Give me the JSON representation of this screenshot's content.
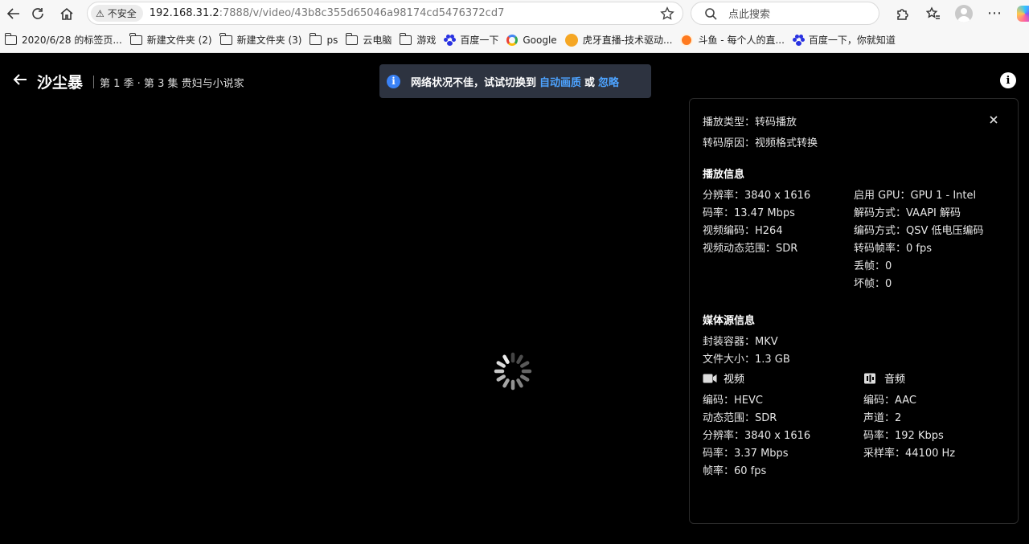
{
  "browser": {
    "security_label": "不安全",
    "url_host": "192.168.31.2",
    "url_rest": ":7888/v/video/43b8c355d65046a98174cd5476372cd7",
    "search_placeholder": "点此搜索"
  },
  "bookmarks": [
    {
      "label": "2020/6/28 的标签页...",
      "icon": "folder-icon"
    },
    {
      "label": "新建文件夹 (2)",
      "icon": "folder-icon"
    },
    {
      "label": "新建文件夹 (3)",
      "icon": "folder-icon"
    },
    {
      "label": "ps",
      "icon": "folder-icon"
    },
    {
      "label": "云电脑",
      "icon": "folder-icon"
    },
    {
      "label": "游戏",
      "icon": "folder-icon"
    },
    {
      "label": "百度一下",
      "icon": "baidu-icon"
    },
    {
      "label": "Google",
      "icon": "google-icon"
    },
    {
      "label": "虎牙直播-技术驱动...",
      "icon": "huya-icon"
    },
    {
      "label": "斗鱼 - 每个人的直...",
      "icon": "douyu-icon"
    },
    {
      "label": "百度一下，你就知道",
      "icon": "baidu-icon"
    }
  ],
  "player": {
    "title": "沙尘暴",
    "episode": "第 1 季 · 第 3 集 贵妇与小说家",
    "toast": {
      "message": "网络状况不佳，试试切换到",
      "link_auto": "自动画质",
      "or": "或",
      "link_ignore": "忽略"
    }
  },
  "panel": {
    "play_type": "播放类型：转码播放",
    "transcode_reason": "转码原因：视频格式转换",
    "play_info_heading": "播放信息",
    "play_info_left": [
      "分辨率：3840 x 1616",
      "码率：13.47 Mbps",
      "视频编码：H264",
      "视频动态范围：SDR"
    ],
    "play_info_right": [
      "启用 GPU：GPU 1 - Intel",
      "解码方式：VAAPI 解码",
      "编码方式：QSV 低电压编码",
      "转码帧率：0 fps",
      "丢帧：0",
      "坏帧：0"
    ],
    "media_heading": "媒体源信息",
    "container": "封装容器：MKV",
    "file_size": "文件大小：1.3 GB",
    "video_heading": "视频",
    "video": [
      "编码：HEVC",
      "动态范围：SDR",
      "分辨率：3840 x 1616",
      "码率：3.37 Mbps",
      "帧率：60 fps"
    ],
    "audio_heading": "音频",
    "audio": [
      "编码：AAC",
      "声道：2",
      "码率：192 Kbps",
      "采样率：44100 Hz"
    ]
  }
}
